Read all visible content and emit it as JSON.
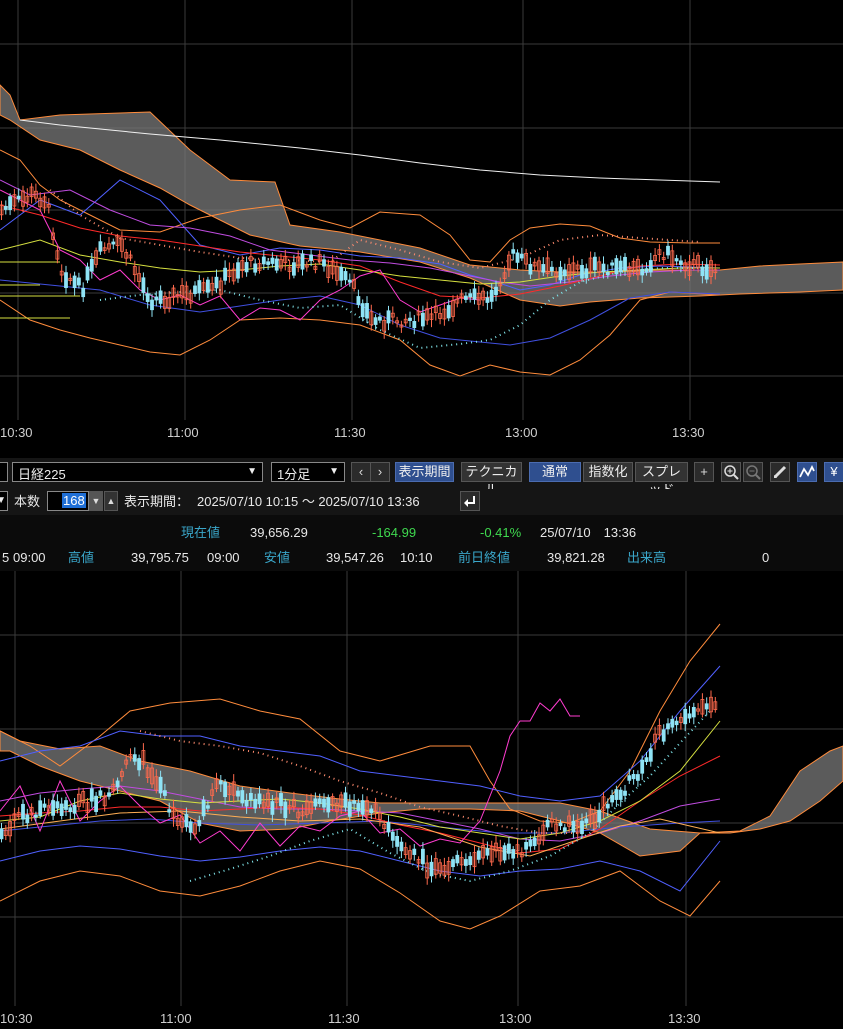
{
  "chart_top": {
    "time_labels": [
      "10:30",
      "11:00",
      "11:30",
      "13:00",
      "13:30"
    ]
  },
  "toolbar": {
    "symbol": "日経225",
    "interval": "1分足",
    "prev_label": "‹",
    "next_label": "›",
    "period_button": "表示期間",
    "technical_button": "テクニカル",
    "mode_normal": "通常",
    "mode_index": "指数化",
    "mode_spread": "スプレッド",
    "icons": [
      "plus-icon",
      "zoom-in-icon",
      "zoom-out-icon",
      "pencil-icon",
      "chart-line-icon",
      "yen-icon"
    ],
    "yen_label": "¥"
  },
  "period_row": {
    "count_label": "本数",
    "count_value": "168",
    "period_label": "表示期間：",
    "period_value": "2025/07/10 10:15 ～ 2025/07/10 13:36"
  },
  "quote": {
    "current_label": "現在値",
    "current_value": "39,656.29",
    "change": "-164.99",
    "change_pct": "-0.41%",
    "timestamp": "25/07/10　13:36",
    "open_fragment": "5",
    "open_time": "09:00",
    "high_label": "高値",
    "high_value": "39,795.75",
    "high_time": "09:00",
    "low_label": "安値",
    "low_value": "39,547.26",
    "low_time": "10:10",
    "prev_close_label": "前日終値",
    "prev_close_value": "39,821.28",
    "volume_label": "出来高",
    "volume_value": "0"
  },
  "chart_bottom": {
    "time_labels": [
      "10:30",
      "11:00",
      "11:30",
      "13:00",
      "13:30"
    ]
  },
  "colors": {
    "grid": "#3a3a3a",
    "cloud": "#707070",
    "up_candle": "#8fe3f5",
    "down_candle": "#ff6a4d",
    "bollinger": "#ff8c3c",
    "ma_blue": "#5060ff",
    "ma_purple": "#c04ce0",
    "ma_red": "#ff2a2a",
    "ma_yellow": "#d6e040",
    "magenta": "#ff3cd0",
    "white_line": "#f0f0f0"
  }
}
